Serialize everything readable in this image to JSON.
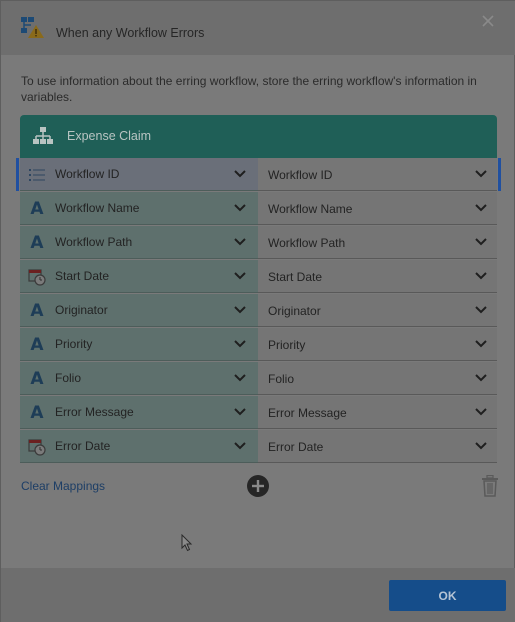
{
  "dialog": {
    "title": "When any Workflow Errors",
    "intro": "To use information about the erring workflow, store the erring workflow's information in variables.",
    "header_icon": "workflow-warning-icon",
    "close_icon": "close-icon"
  },
  "grid": {
    "title": "Expense Claim",
    "title_icon": "workflow-icon",
    "rows": [
      {
        "icon": "list-icon",
        "left": "Workflow ID",
        "right": "Workflow ID",
        "selected": true
      },
      {
        "icon": "text-icon",
        "left": "Workflow Name",
        "right": "Workflow Name"
      },
      {
        "icon": "text-icon",
        "left": "Workflow Path",
        "right": "Workflow Path"
      },
      {
        "icon": "calendar-clock-icon",
        "left": "Start Date",
        "right": "Start Date"
      },
      {
        "icon": "text-icon",
        "left": "Originator",
        "right": "Originator"
      },
      {
        "icon": "text-icon",
        "left": "Priority",
        "right": "Priority"
      },
      {
        "icon": "text-icon",
        "left": "Folio",
        "right": "Folio"
      },
      {
        "icon": "text-icon",
        "left": "Error Message",
        "right": "Error Message"
      },
      {
        "icon": "calendar-clock-icon",
        "left": "Error Date",
        "right": "Error Date"
      }
    ]
  },
  "actions": {
    "clear_mappings": "Clear Mappings",
    "add_icon": "plus-circle-icon",
    "delete_icon": "trash-icon"
  },
  "footer": {
    "ok_label": "OK"
  },
  "colors": {
    "accent": "#1f5f57",
    "primary_button": "#154d8a",
    "selection": "#2050a0"
  }
}
